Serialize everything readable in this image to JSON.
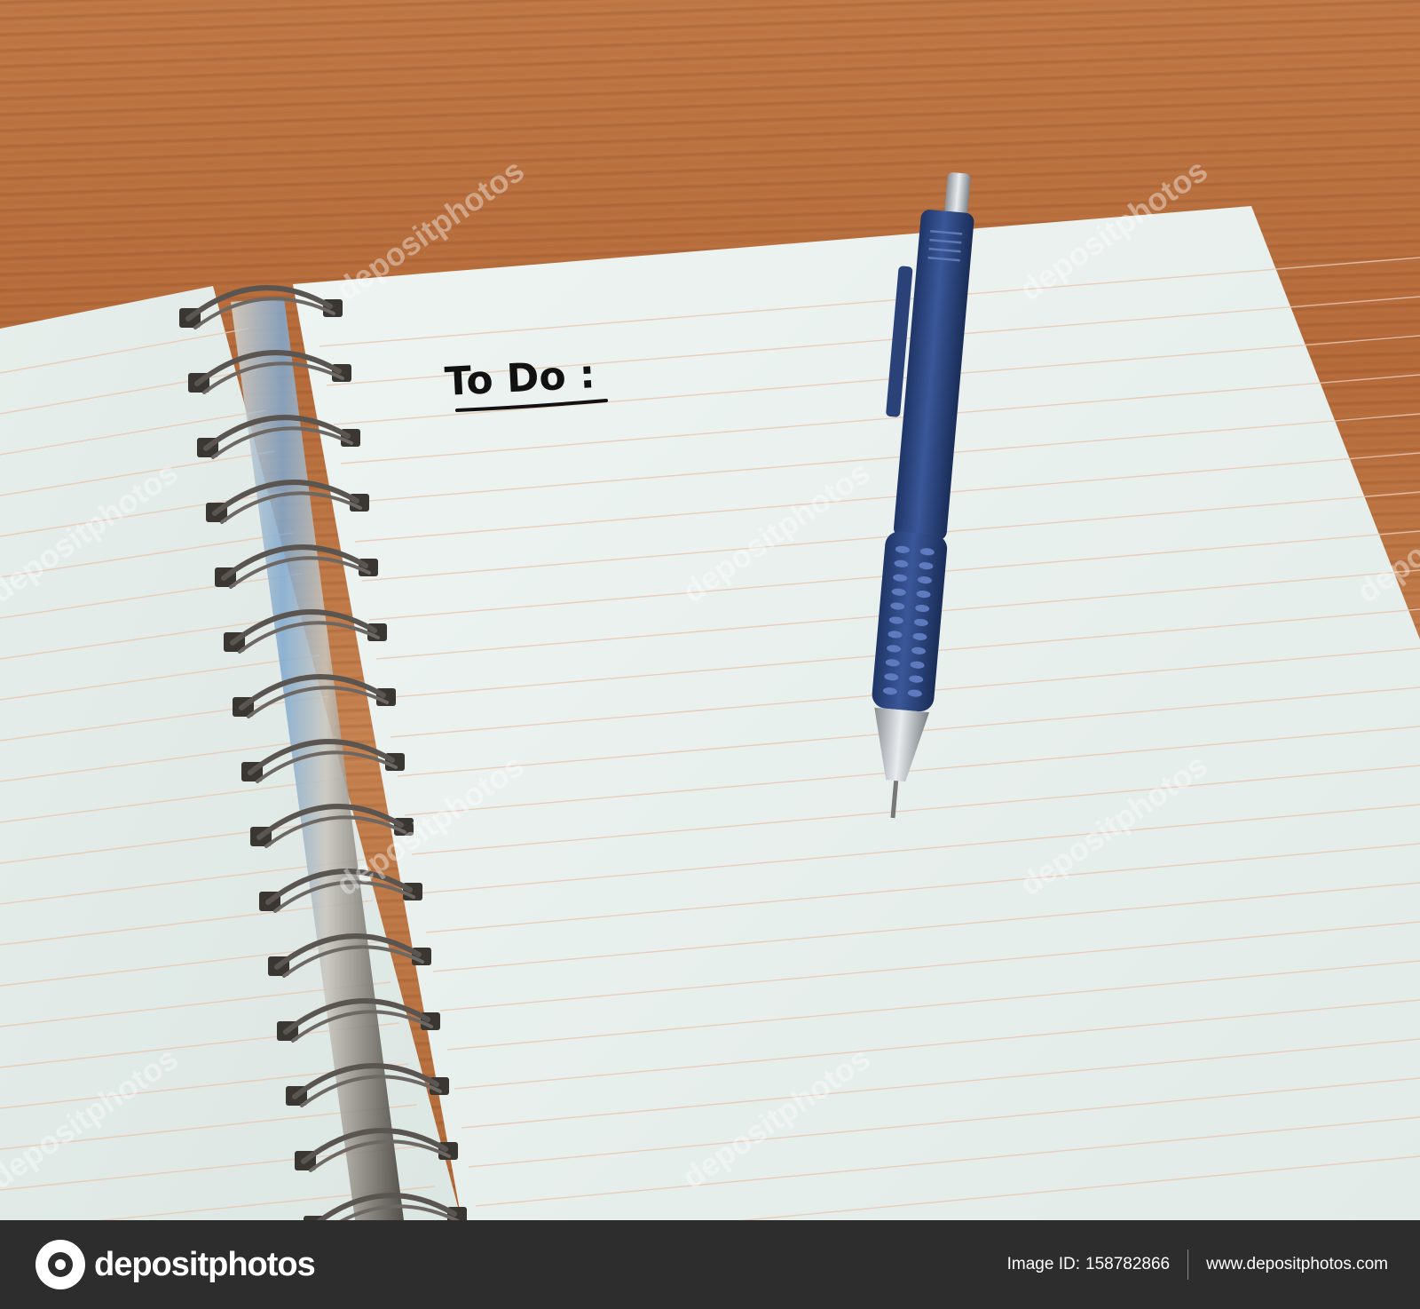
{
  "photo": {
    "handwritten_heading": "To Do :",
    "watermark_text": "depositphotos",
    "colors": {
      "table_wood": "#c27a48",
      "paper": "#eef3f1",
      "pencil_body": "#2e4a86",
      "spiral_wire": "#5a5550"
    }
  },
  "footer": {
    "brand_name": "depositphotos",
    "image_id_label": "Image ID:",
    "image_id": "158782866",
    "site_url": "www.depositphotos.com"
  }
}
